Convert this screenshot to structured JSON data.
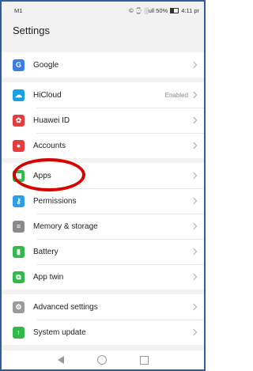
{
  "status": {
    "carrier": "M1",
    "right": "© ⌚ ░ull 50%",
    "time": "4:11 pr"
  },
  "header": {
    "title": "Settings"
  },
  "groups": [
    [
      {
        "label": "Google",
        "icon": "google-icon",
        "color": "#3d7de6"
      }
    ],
    [
      {
        "label": "HiCloud",
        "icon": "cloud-icon",
        "color": "#19a0e5",
        "value": "Enabled"
      },
      {
        "label": "Huawei ID",
        "icon": "huawei-icon",
        "color": "#e53c3c"
      },
      {
        "label": "Accounts",
        "icon": "account-icon",
        "color": "#e53c3c"
      }
    ],
    [
      {
        "label": "Apps",
        "icon": "apps-icon",
        "color": "#33b949"
      },
      {
        "label": "Permissions",
        "icon": "key-icon",
        "color": "#2c9ee8"
      },
      {
        "label": "Memory & storage",
        "icon": "storage-icon",
        "color": "#8a8a8a"
      },
      {
        "label": "Battery",
        "icon": "battery-icon",
        "color": "#33b949"
      },
      {
        "label": "App twin",
        "icon": "app-twin-icon",
        "color": "#33b949"
      }
    ],
    [
      {
        "label": "Advanced settings",
        "icon": "gear-icon",
        "color": "#9a9a9a"
      },
      {
        "label": "System update",
        "icon": "update-icon",
        "color": "#33b949"
      }
    ]
  ]
}
